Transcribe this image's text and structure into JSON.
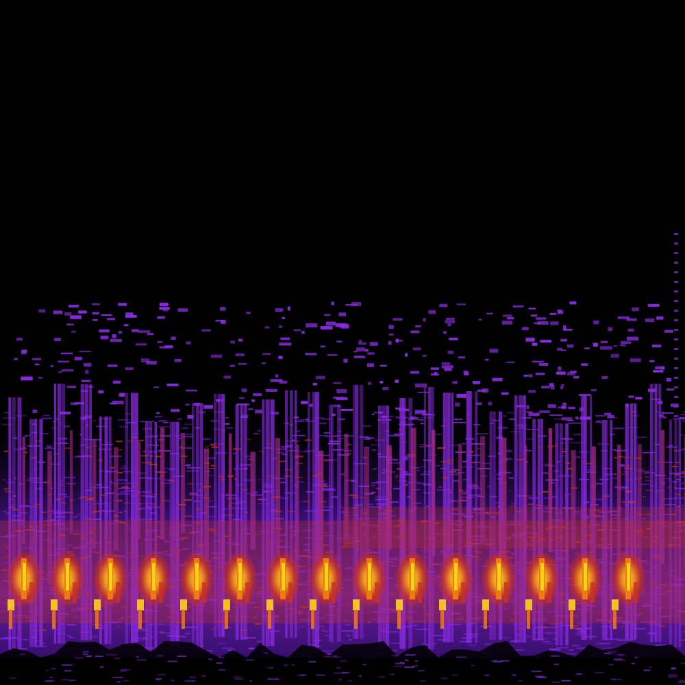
{
  "image": {
    "kind": "spectrogram",
    "colormap": "black-purple-red-orange-yellow",
    "background_color": "#000000"
  },
  "palette": {
    "low": "#8a2be2",
    "low_alt": "#7b1fe8",
    "mid": "#a02a8a",
    "high": "#c8321e",
    "hot": "#f07a10",
    "peak": "#ffd21a"
  },
  "pattern": {
    "repeating_pulses": 15
  }
}
